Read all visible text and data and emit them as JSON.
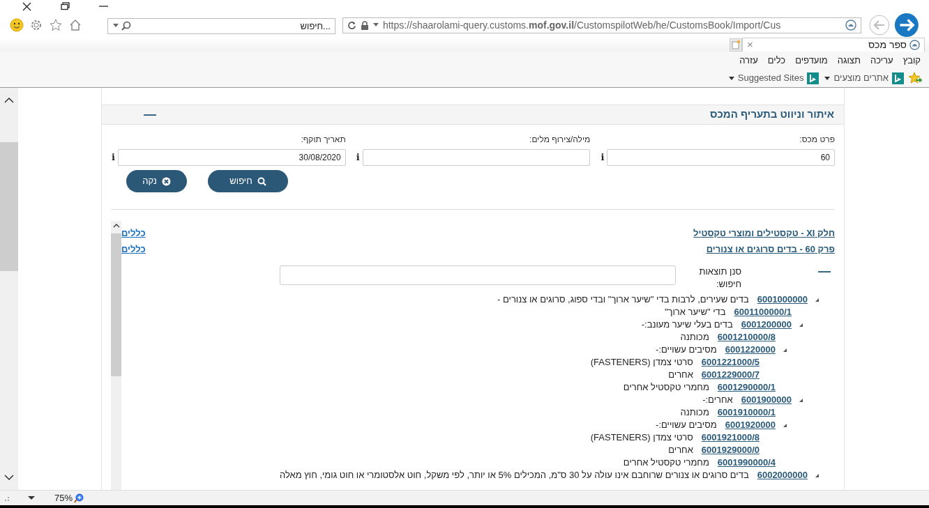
{
  "search_box": {
    "placeholder": "...חיפוש"
  },
  "address_bar": {
    "url": "https://shaarolami-query.customs.**mof.gov.il**/CustomspilotWeb/he/CustomsBook/Import/Cus"
  },
  "tab": {
    "title": "ספר מכס",
    "close": "×"
  },
  "menu": [
    "קובץ",
    "עריכה",
    "תצוגה",
    "מועדפים",
    "כלים",
    "עזרה"
  ],
  "favorites": [
    "אתרים מוצעים",
    "Suggested Sites"
  ],
  "panel": {
    "title": "איתור וניווט בתעריף המכס",
    "collapse": "—",
    "fields": [
      {
        "label": "פרט מכס:",
        "value": "60",
        "info": "i"
      },
      {
        "label": "מילה/צירוף מלים:",
        "info": "i"
      },
      {
        "label": "תאריך תוקף:",
        "value": "30/08/2020",
        "info": "i"
      }
    ],
    "buttons": [
      {
        "kind": "search",
        "label": "חיפוש"
      },
      {
        "kind": "clear",
        "label": "נקה"
      }
    ]
  },
  "results": {
    "links": [
      {
        "title": "חלק XI - טקסטילים ומוצרי טקסטיל",
        "rules": "כללים"
      },
      {
        "title": "פרק 60 - בדים סרוגים או צנורים",
        "rules": "כללים"
      }
    ],
    "filter": {
      "collapse": "—",
      "label": "סנן תוצאות חיפוש:"
    },
    "tree": [
      {
        "expandable": true,
        "code": "6001000000",
        "text": "בדים שעירים, לרבות בדי \"שיער ארוך\" ובדי ספוג, סרוגים או צנורים -",
        "children": [
          {
            "expandable": false,
            "code": "6001100000/1",
            "text": "בדי \"שיער ארוך\""
          },
          {
            "expandable": true,
            "code": "6001200000",
            "text": "בדים בעלי שיער מעונב:-",
            "children": [
              {
                "expandable": false,
                "code": "6001210000/8",
                "text": "מכותנה"
              },
              {
                "expandable": true,
                "code": "6001220000",
                "text": "מסיבים עשויים:-",
                "children": [
                  {
                    "expandable": false,
                    "code": "6001221000/5",
                    "text": "סרטי צמדן (FASTENERS)"
                  },
                  {
                    "expandable": false,
                    "code": "6001229000/7",
                    "text": "אחרים"
                  }
                ]
              },
              {
                "expandable": false,
                "code": "6001290000/1",
                "text": "מחמרי טקסטיל אחרים"
              }
            ]
          },
          {
            "expandable": true,
            "code": "6001900000",
            "text": "אחרים:-",
            "children": [
              {
                "expandable": false,
                "code": "6001910000/1",
                "text": "מכותנה"
              },
              {
                "expandable": true,
                "code": "6001920000",
                "text": "מסיבים עשויים:-",
                "children": [
                  {
                    "expandable": false,
                    "code": "6001921000/8",
                    "text": "סרטי צמדן (FASTENERS)"
                  },
                  {
                    "expandable": false,
                    "code": "6001929000/0",
                    "text": "אחרים"
                  }
                ]
              },
              {
                "expandable": false,
                "code": "6001990000/4",
                "text": "מחמרי טקסטיל אחרים"
              }
            ]
          }
        ]
      },
      {
        "expandable": true,
        "code": "6002000000",
        "text": "בדים סרוגים או צנורים שרוחבם אינו עולה על 30 ס\"מ, המכילים 5% או יותר, לפי משקל, חוט אלסטומרי או חוט גומי, חוץ מאלה"
      }
    ]
  },
  "status_bar": {
    "zoom": "75%"
  }
}
